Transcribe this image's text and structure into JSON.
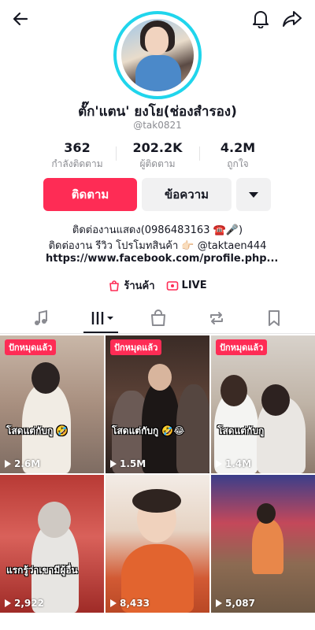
{
  "profile": {
    "display_name": "ตั๊ก'แตน' ยงโย(ช่องสำรอง)",
    "handle": "@tak0821",
    "stats": [
      {
        "value": "362",
        "label": "กำลังติดตาม"
      },
      {
        "value": "202.2K",
        "label": "ผู้ติดตาม"
      },
      {
        "value": "4.2M",
        "label": "ถูกใจ"
      }
    ],
    "follow_label": "ติดตาม",
    "message_label": "ข้อความ",
    "bio_line1": "ติดต่องานแสดง(0986483163 ☎️🎤)",
    "bio_line2": "ติดต่องาน รีวิว โปรโมทสินค้า 👉🏻 @taktaen444",
    "link": "https://www.facebook.com/profile.php...",
    "shop_label": "ร้านค้า",
    "live_label": "LIVE"
  },
  "colors": {
    "accent": "#fe2c55",
    "ring": "#20d5ec"
  },
  "videos": [
    {
      "badge": "ปักหมุดแล้ว",
      "caption": "โสดแต่กับกู 🤣",
      "views": "2.6M"
    },
    {
      "badge": "ปักหมุดแล้ว",
      "caption": "โสดแต่กับกู 🤣😂",
      "views": "1.5M"
    },
    {
      "badge": "ปักหมุดแล้ว",
      "caption": "โสดแต่กับกู",
      "views": "1.4M"
    },
    {
      "badge": "",
      "caption": "แรกรู้ว่าเขามีผู้อื่น",
      "views": "2,922"
    },
    {
      "badge": "",
      "caption": "",
      "views": "8,433"
    },
    {
      "badge": "",
      "caption": "",
      "views": "5,087"
    }
  ]
}
